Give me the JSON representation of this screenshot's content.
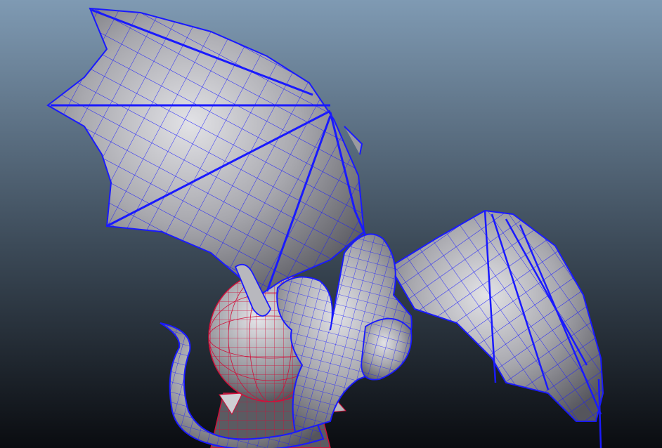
{
  "viewport": {
    "background_top": "#7f9ab3",
    "background_bottom": "#0a0c10",
    "wireframe_color": "#1a1aff",
    "selected_wireframe_color": "#d0103a",
    "surface_light": "#d8d8dc",
    "surface_dark": "#5a5a62"
  },
  "scene": {
    "objects": [
      {
        "name": "dragon-mesh",
        "selected": false
      },
      {
        "name": "sphere-pedestal",
        "selected": true
      }
    ]
  }
}
